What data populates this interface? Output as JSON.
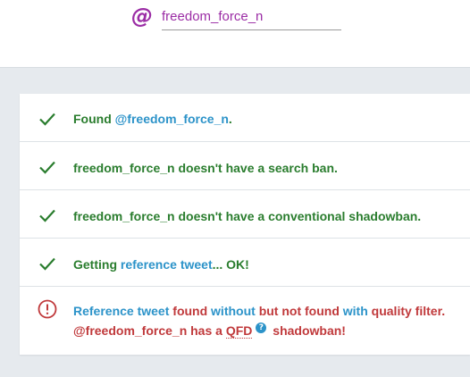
{
  "header": {
    "at_symbol": "@",
    "username_value": "freedom_force_n",
    "accent_color": "#9b2da5"
  },
  "results": [
    {
      "status": "ok",
      "icon": "check-icon",
      "parts": [
        {
          "text": "Found ",
          "color": "green"
        },
        {
          "text": "@freedom_force_n",
          "color": "blue"
        },
        {
          "text": ".",
          "color": "green"
        }
      ]
    },
    {
      "status": "ok",
      "icon": "check-icon",
      "parts": [
        {
          "text": "freedom_force_n doesn't have a search ban.",
          "color": "green"
        }
      ]
    },
    {
      "status": "ok",
      "icon": "check-icon",
      "parts": [
        {
          "text": "freedom_force_n doesn't have a conventional shadowban.",
          "color": "green"
        }
      ]
    },
    {
      "status": "ok",
      "icon": "check-icon",
      "parts": [
        {
          "text": "Getting ",
          "color": "green"
        },
        {
          "text": "reference tweet",
          "color": "blue"
        },
        {
          "text": "... OK!",
          "color": "green"
        }
      ]
    },
    {
      "status": "fail",
      "icon": "alert-circle-icon",
      "line1": [
        {
          "text": "Reference tweet",
          "color": "blue"
        },
        {
          "text": " found ",
          "color": "red"
        },
        {
          "text": "without",
          "color": "blue"
        },
        {
          "text": " but not found ",
          "color": "red"
        },
        {
          "text": "with",
          "color": "blue"
        },
        {
          "text": " quality filter.",
          "color": "red"
        }
      ],
      "line2_prefix": "@freedom_force_n has a ",
      "qfd_label": "QFD",
      "help_glyph": "?",
      "line2_suffix": " shadowban!"
    }
  ],
  "colors": {
    "green": "#2a7d2e",
    "blue": "#2c93c9",
    "red": "#c0393b"
  }
}
